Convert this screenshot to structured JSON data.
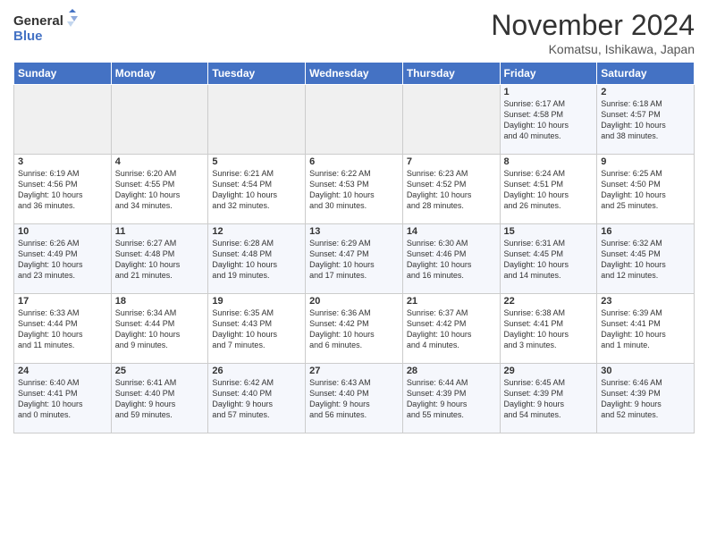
{
  "logo": {
    "line1": "General",
    "line2": "Blue"
  },
  "header": {
    "month_year": "November 2024",
    "location": "Komatsu, Ishikawa, Japan"
  },
  "weekdays": [
    "Sunday",
    "Monday",
    "Tuesday",
    "Wednesday",
    "Thursday",
    "Friday",
    "Saturday"
  ],
  "weeks": [
    [
      {
        "day": "",
        "info": ""
      },
      {
        "day": "",
        "info": ""
      },
      {
        "day": "",
        "info": ""
      },
      {
        "day": "",
        "info": ""
      },
      {
        "day": "",
        "info": ""
      },
      {
        "day": "1",
        "info": "Sunrise: 6:17 AM\nSunset: 4:58 PM\nDaylight: 10 hours\nand 40 minutes."
      },
      {
        "day": "2",
        "info": "Sunrise: 6:18 AM\nSunset: 4:57 PM\nDaylight: 10 hours\nand 38 minutes."
      }
    ],
    [
      {
        "day": "3",
        "info": "Sunrise: 6:19 AM\nSunset: 4:56 PM\nDaylight: 10 hours\nand 36 minutes."
      },
      {
        "day": "4",
        "info": "Sunrise: 6:20 AM\nSunset: 4:55 PM\nDaylight: 10 hours\nand 34 minutes."
      },
      {
        "day": "5",
        "info": "Sunrise: 6:21 AM\nSunset: 4:54 PM\nDaylight: 10 hours\nand 32 minutes."
      },
      {
        "day": "6",
        "info": "Sunrise: 6:22 AM\nSunset: 4:53 PM\nDaylight: 10 hours\nand 30 minutes."
      },
      {
        "day": "7",
        "info": "Sunrise: 6:23 AM\nSunset: 4:52 PM\nDaylight: 10 hours\nand 28 minutes."
      },
      {
        "day": "8",
        "info": "Sunrise: 6:24 AM\nSunset: 4:51 PM\nDaylight: 10 hours\nand 26 minutes."
      },
      {
        "day": "9",
        "info": "Sunrise: 6:25 AM\nSunset: 4:50 PM\nDaylight: 10 hours\nand 25 minutes."
      }
    ],
    [
      {
        "day": "10",
        "info": "Sunrise: 6:26 AM\nSunset: 4:49 PM\nDaylight: 10 hours\nand 23 minutes."
      },
      {
        "day": "11",
        "info": "Sunrise: 6:27 AM\nSunset: 4:48 PM\nDaylight: 10 hours\nand 21 minutes."
      },
      {
        "day": "12",
        "info": "Sunrise: 6:28 AM\nSunset: 4:48 PM\nDaylight: 10 hours\nand 19 minutes."
      },
      {
        "day": "13",
        "info": "Sunrise: 6:29 AM\nSunset: 4:47 PM\nDaylight: 10 hours\nand 17 minutes."
      },
      {
        "day": "14",
        "info": "Sunrise: 6:30 AM\nSunset: 4:46 PM\nDaylight: 10 hours\nand 16 minutes."
      },
      {
        "day": "15",
        "info": "Sunrise: 6:31 AM\nSunset: 4:45 PM\nDaylight: 10 hours\nand 14 minutes."
      },
      {
        "day": "16",
        "info": "Sunrise: 6:32 AM\nSunset: 4:45 PM\nDaylight: 10 hours\nand 12 minutes."
      }
    ],
    [
      {
        "day": "17",
        "info": "Sunrise: 6:33 AM\nSunset: 4:44 PM\nDaylight: 10 hours\nand 11 minutes."
      },
      {
        "day": "18",
        "info": "Sunrise: 6:34 AM\nSunset: 4:44 PM\nDaylight: 10 hours\nand 9 minutes."
      },
      {
        "day": "19",
        "info": "Sunrise: 6:35 AM\nSunset: 4:43 PM\nDaylight: 10 hours\nand 7 minutes."
      },
      {
        "day": "20",
        "info": "Sunrise: 6:36 AM\nSunset: 4:42 PM\nDaylight: 10 hours\nand 6 minutes."
      },
      {
        "day": "21",
        "info": "Sunrise: 6:37 AM\nSunset: 4:42 PM\nDaylight: 10 hours\nand 4 minutes."
      },
      {
        "day": "22",
        "info": "Sunrise: 6:38 AM\nSunset: 4:41 PM\nDaylight: 10 hours\nand 3 minutes."
      },
      {
        "day": "23",
        "info": "Sunrise: 6:39 AM\nSunset: 4:41 PM\nDaylight: 10 hours\nand 1 minute."
      }
    ],
    [
      {
        "day": "24",
        "info": "Sunrise: 6:40 AM\nSunset: 4:41 PM\nDaylight: 10 hours\nand 0 minutes."
      },
      {
        "day": "25",
        "info": "Sunrise: 6:41 AM\nSunset: 4:40 PM\nDaylight: 9 hours\nand 59 minutes."
      },
      {
        "day": "26",
        "info": "Sunrise: 6:42 AM\nSunset: 4:40 PM\nDaylight: 9 hours\nand 57 minutes."
      },
      {
        "day": "27",
        "info": "Sunrise: 6:43 AM\nSunset: 4:40 PM\nDaylight: 9 hours\nand 56 minutes."
      },
      {
        "day": "28",
        "info": "Sunrise: 6:44 AM\nSunset: 4:39 PM\nDaylight: 9 hours\nand 55 minutes."
      },
      {
        "day": "29",
        "info": "Sunrise: 6:45 AM\nSunset: 4:39 PM\nDaylight: 9 hours\nand 54 minutes."
      },
      {
        "day": "30",
        "info": "Sunrise: 6:46 AM\nSunset: 4:39 PM\nDaylight: 9 hours\nand 52 minutes."
      }
    ]
  ]
}
